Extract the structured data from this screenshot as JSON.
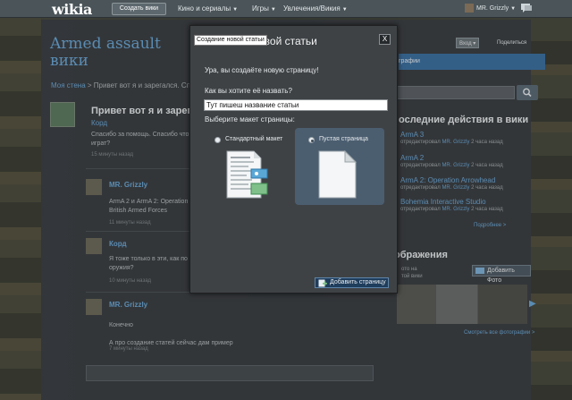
{
  "topbar": {
    "logo": "wikia",
    "create_wiki": "Создать вики",
    "nav": [
      "Кино и сериалы",
      "Игры",
      "Увлечения/Викия"
    ],
    "user": "MR. Grizzly"
  },
  "page": {
    "wiki_title_line1": "Armed assault",
    "wiki_title_line2": "вики",
    "breadcrumb_link": "Моя стена",
    "breadcrumb_sep": ">",
    "breadcrumb_current": "Привет вот я и зарегался. Сп",
    "login_btn": "Вход",
    "share_btn": "Поделиться",
    "rail_tab": "графии",
    "post": {
      "title": "Привет вот я и зарегал",
      "author": "Корд",
      "text_line1": "Спасибо за помощь. Спасибо что",
      "text_line2": "играт?",
      "time": "15 минуты назад"
    },
    "replies": [
      {
        "name": "MR. Grizzly",
        "text_line1": "ArmA 2 и ArmA 2: Operation",
        "text_line2": "British Armed Forces",
        "time": "11 минуты назад"
      },
      {
        "name": "Корд",
        "text_line1": "Я тоже только в эти, как по",
        "text_line2": "оружия?",
        "time": "10 минуты назад"
      },
      {
        "name": "MR. Grizzly",
        "text_line1": "Конечно",
        "text_line2": "А про создание  статей сейчас дам пример",
        "time": "7 минуты назад"
      }
    ]
  },
  "rail": {
    "activity_head": "оследние действия в вики",
    "activity": [
      {
        "title": "ArmA 3",
        "sub": "отредактировал",
        "user": "MR. Grizzly",
        "time": "2 часа назад"
      },
      {
        "title": "ArmA 2",
        "sub": "отредактировал",
        "user": "MR. Grizzly",
        "time": "2 часа назад"
      },
      {
        "title": "ArmA 2: Operation Arrowhead",
        "sub": "отредактировал",
        "user": "MR. Grizzly",
        "time": "2 часа назад"
      },
      {
        "title": "Bohemia Interactive Studio",
        "sub": "отредактировал",
        "user": "MR. Grizzly",
        "time": "2 часа назад"
      }
    ],
    "more": "Подробнее >",
    "images_head": "ображения",
    "images_note_line1": "ото на",
    "images_note_line2": "той вики",
    "add_photo": "Добавить Фото",
    "see_more_photos": "Смотреть все фотографии >"
  },
  "modal": {
    "title": "овой статьи",
    "tooltip": "Создание новой статьи",
    "close": "X",
    "intro": "Ура, вы создаёте новую страницу!",
    "name_label": "Как вы хотите её назвать?",
    "name_value": "Тут пишеш название статьи",
    "layout_label": "Выберите макет страницы:",
    "options": [
      {
        "label": "Стандартный макет",
        "selected": false
      },
      {
        "label": "Пустая страница",
        "selected": true
      }
    ],
    "submit": "Добавить страницу"
  },
  "colors": {
    "accent": "#6aa6d6",
    "modal_bg": "#3f4245",
    "selected_option": "#4b5e70",
    "submit_bg": "#1f3d5c"
  },
  "icons": [
    "messages-icon",
    "close-icon",
    "standard-layout-icon",
    "blank-page-icon",
    "add-page-icon",
    "camera-icon",
    "search-icon",
    "chevron-right-icon"
  ]
}
